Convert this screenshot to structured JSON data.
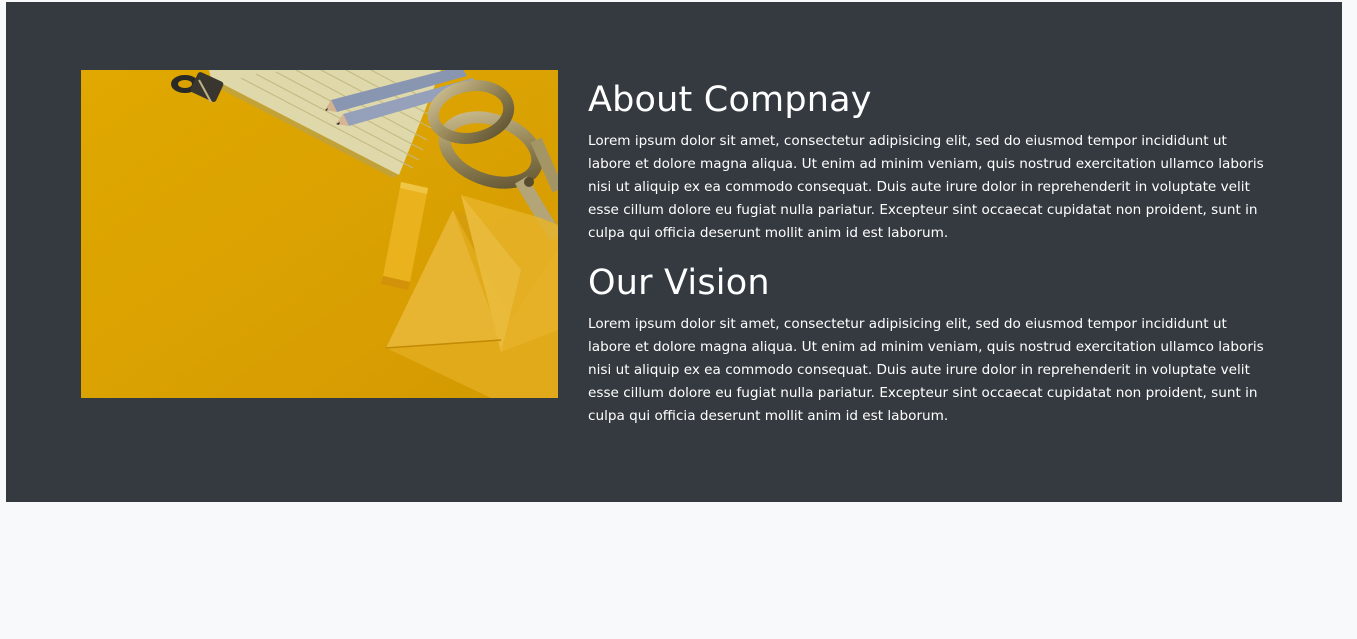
{
  "about": {
    "title": "About Compnay",
    "body": "Lorem ipsum dolor sit amet, consectetur adipisicing elit, sed do eiusmod tempor incididunt ut labore et dolore magna aliqua. Ut enim ad minim veniam, quis nostrud exercitation ullamco laboris nisi ut aliquip ex ea commodo consequat. Duis aute irure dolor in reprehenderit in voluptate velit esse cillum dolore eu fugiat nulla pariatur. Excepteur sint occaecat cupidatat non proident, sunt in culpa qui officia deserunt mollit anim id est laborum."
  },
  "vision": {
    "title": "Our Vision",
    "body": "Lorem ipsum dolor sit amet, consectetur adipisicing elit, sed do eiusmod tempor incididunt ut labore et dolore magna aliqua. Ut enim ad minim veniam, quis nostrud exercitation ullamco laboris nisi ut aliquip ex ea commodo consequat. Duis aute irure dolor in reprehenderit in voluptate velit esse cillum dolore eu fugiat nulla pariatur. Excepteur sint occaecat cupidatat non proident, sunt in culpa qui officia deserunt mollit anim id est laborum."
  },
  "image": {
    "subject": "stationery-flatlay-image"
  },
  "colors": {
    "section_bg": "#343a40",
    "page_bg": "#f8f9fb",
    "image_yellow": "#e3aa05",
    "text": "#ffffff"
  }
}
